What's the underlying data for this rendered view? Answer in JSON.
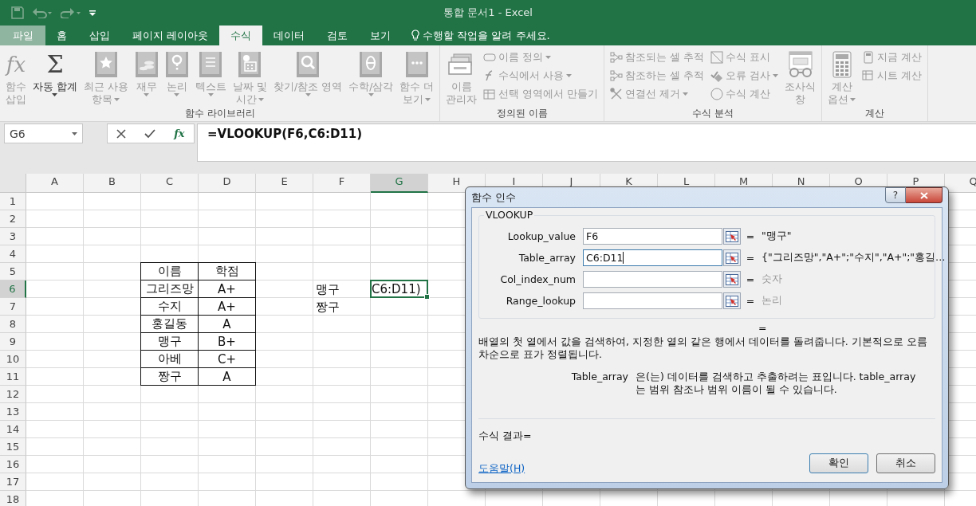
{
  "title": "통합 문서1 - Excel",
  "tabs": [
    {
      "label": "파일",
      "selected": false,
      "kind": "file"
    },
    {
      "label": "홈",
      "selected": false,
      "kind": "tab"
    },
    {
      "label": "삽입",
      "selected": false,
      "kind": "tab"
    },
    {
      "label": "페이지 레이아웃",
      "selected": false,
      "kind": "tab"
    },
    {
      "label": "수식",
      "selected": true,
      "kind": "tab"
    },
    {
      "label": "데이터",
      "selected": false,
      "kind": "tab"
    },
    {
      "label": "검토",
      "selected": false,
      "kind": "tab"
    },
    {
      "label": "보기",
      "selected": false,
      "kind": "tab"
    }
  ],
  "tell_me": "수행할 작업을 알려 주세요.",
  "ribbon_groups": [
    {
      "label": "함수 라이브러리",
      "items": [
        {
          "kind": "large",
          "lines": [
            "함수",
            "삽입"
          ],
          "symbol": "fx",
          "disabled": true,
          "dropdown": false
        },
        {
          "kind": "large",
          "lines": [
            "자동 합계"
          ],
          "symbol": "Σ",
          "disabled": false,
          "dropdown": true
        },
        {
          "kind": "large",
          "lines": [
            "최근 사용",
            "항목"
          ],
          "disabled": true,
          "dropdown": true
        },
        {
          "kind": "large",
          "lines": [
            "재무"
          ],
          "disabled": true,
          "dropdown": true
        },
        {
          "kind": "large",
          "lines": [
            "논리"
          ],
          "disabled": true,
          "dropdown": true
        },
        {
          "kind": "large",
          "lines": [
            "텍스트"
          ],
          "disabled": true,
          "dropdown": true
        },
        {
          "kind": "large",
          "lines": [
            "날짜 및",
            "시간"
          ],
          "disabled": true,
          "dropdown": true
        },
        {
          "kind": "large",
          "lines": [
            "찾기/참조 영역"
          ],
          "disabled": true,
          "dropdown": true
        },
        {
          "kind": "large",
          "lines": [
            "수학/삼각"
          ],
          "disabled": true,
          "dropdown": true
        },
        {
          "kind": "large",
          "lines": [
            "함수 더",
            "보기"
          ],
          "disabled": true,
          "dropdown": true
        }
      ]
    },
    {
      "label": "정의된 이름",
      "items": [
        {
          "kind": "large",
          "lines": [
            "이름",
            "관리자"
          ],
          "disabled": true,
          "dropdown": false
        },
        {
          "kind": "stack",
          "buttons": [
            {
              "label": "이름 정의",
              "disabled": true,
              "dropdown": true
            },
            {
              "label": "수식에서 사용",
              "disabled": true,
              "dropdown": true
            },
            {
              "label": "선택 영역에서 만들기",
              "disabled": true,
              "dropdown": false
            }
          ]
        }
      ]
    },
    {
      "label": "수식 분석",
      "items": [
        {
          "kind": "stack",
          "buttons": [
            {
              "label": "참조되는 셀 추적",
              "disabled": true,
              "dropdown": false
            },
            {
              "label": "참조하는 셀 추적",
              "disabled": true,
              "dropdown": false
            },
            {
              "label": "연결선 제거",
              "disabled": true,
              "dropdown": true
            }
          ]
        },
        {
          "kind": "stack",
          "buttons": [
            {
              "label": "수식 표시",
              "disabled": true,
              "dropdown": false
            },
            {
              "label": "오류 검사",
              "disabled": true,
              "dropdown": true
            },
            {
              "label": "수식 계산",
              "disabled": true,
              "dropdown": false
            }
          ]
        },
        {
          "kind": "large",
          "lines": [
            "조사식",
            "창"
          ],
          "disabled": true,
          "dropdown": false
        }
      ]
    },
    {
      "label": "계산",
      "items": [
        {
          "kind": "large",
          "lines": [
            "계산",
            "옵션"
          ],
          "disabled": true,
          "dropdown": true
        },
        {
          "kind": "stack",
          "buttons": [
            {
              "label": "지금 계산",
              "disabled": true,
              "dropdown": false
            },
            {
              "label": "시트 계산",
              "disabled": true,
              "dropdown": false
            }
          ]
        }
      ]
    }
  ],
  "name_box": "G6",
  "formula_bar": {
    "function_symbol": "fx",
    "formula": "=VLOOKUP(F6,C6:D11)"
  },
  "sheet": {
    "columns": [
      {
        "label": "A",
        "selected": false
      },
      {
        "label": "B",
        "selected": false
      },
      {
        "label": "C",
        "selected": false
      },
      {
        "label": "D",
        "selected": false
      },
      {
        "label": "E",
        "selected": false
      },
      {
        "label": "F",
        "selected": false
      },
      {
        "label": "G",
        "selected": true
      },
      {
        "label": "H",
        "selected": false
      },
      {
        "label": "I",
        "selected": false
      },
      {
        "label": "J",
        "selected": false
      },
      {
        "label": "K",
        "selected": false
      },
      {
        "label": "L",
        "selected": false
      },
      {
        "label": "M",
        "selected": false
      },
      {
        "label": "N",
        "selected": false
      },
      {
        "label": "O",
        "selected": false
      },
      {
        "label": "P",
        "selected": false
      },
      {
        "label": "Q",
        "selected": false
      }
    ],
    "rows": [
      {
        "label": "1",
        "selected": false
      },
      {
        "label": "2",
        "selected": false
      },
      {
        "label": "3",
        "selected": false
      },
      {
        "label": "4",
        "selected": false
      },
      {
        "label": "5",
        "selected": false
      },
      {
        "label": "6",
        "selected": true
      },
      {
        "label": "7",
        "selected": false
      },
      {
        "label": "8",
        "selected": false
      },
      {
        "label": "9",
        "selected": false
      },
      {
        "label": "10",
        "selected": false
      },
      {
        "label": "11",
        "selected": false
      },
      {
        "label": "12",
        "selected": false
      },
      {
        "label": "13",
        "selected": false
      },
      {
        "label": "14",
        "selected": false
      },
      {
        "label": "15",
        "selected": false
      },
      {
        "label": "16",
        "selected": false
      },
      {
        "label": "17",
        "selected": false
      },
      {
        "label": "18",
        "selected": false
      }
    ],
    "table": {
      "header": [
        "이름",
        "학점"
      ],
      "rows": [
        [
          "그리즈망",
          "A+"
        ],
        [
          "수지",
          "A+"
        ],
        [
          "홍길동",
          "A"
        ],
        [
          "맹구",
          "B+"
        ],
        [
          "아베",
          "C+"
        ],
        [
          "짱구",
          "A"
        ]
      ]
    },
    "lookup_names": [
      "맹구",
      "짱구"
    ],
    "active_cell": "C6:D11)"
  },
  "dialog": {
    "title": "함수 인수",
    "help_button": "?",
    "function": "VLOOKUP",
    "arguments": [
      {
        "label": "Lookup_value",
        "value": "F6",
        "focused": false,
        "equals": "=",
        "result": "\"맹구\"",
        "dimmed": false
      },
      {
        "label": "Table_array",
        "value": "C6:D11",
        "focused": true,
        "equals": "=",
        "result": "{\"그리즈망\",\"A+\";\"수지\",\"A+\";\"홍길…",
        "dimmed": false
      },
      {
        "label": "Col_index_num",
        "focused": false,
        "equals": "=",
        "result": "숫자",
        "dimmed": true
      },
      {
        "label": "Range_lookup",
        "focused": false,
        "equals": "=",
        "result": "논리",
        "dimmed": true
      }
    ],
    "result_equals": "=",
    "description": "배열의 첫 열에서 값을 검색하여, 지정한 열의 같은 행에서 데이터를 돌려줍니다. 기본적으로 오름차순으로 표가 정렬됩니다.",
    "argument_help": {
      "label": "Table_array",
      "text": "은(는) 데이터를 검색하고 추출하려는 표입니다. table_array는 범위 참조나 범위 이름이 될 수 있습니다."
    },
    "formula_result": "수식 결과=",
    "help_link": "도움말(H)",
    "buttons": [
      {
        "label": "확인",
        "default": true
      },
      {
        "label": "취소",
        "default": false
      }
    ]
  }
}
